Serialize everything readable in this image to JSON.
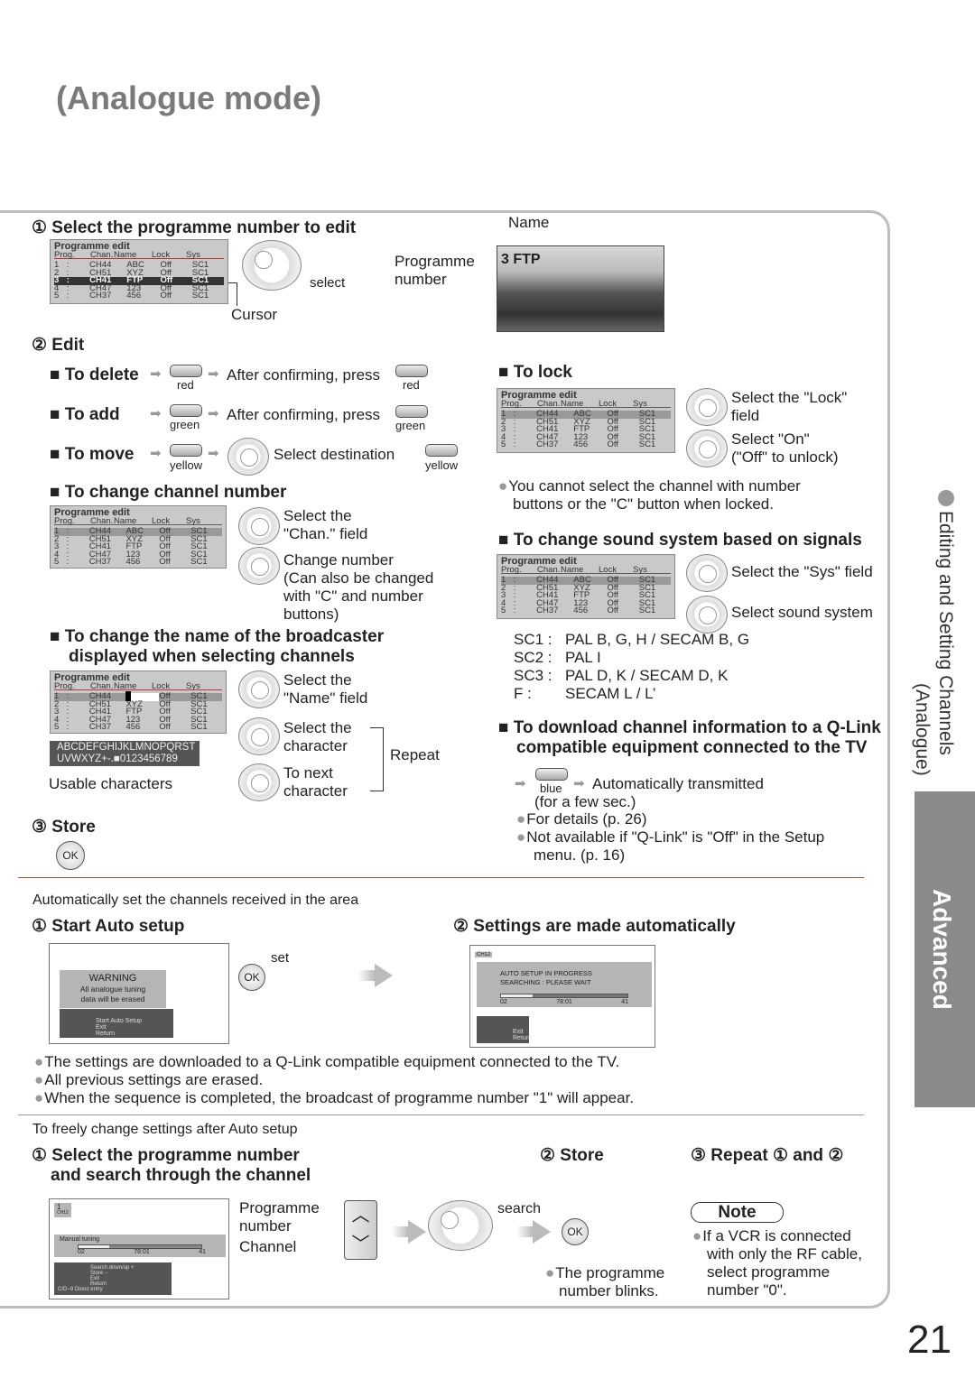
{
  "title": "(Analogue mode)",
  "side": {
    "section": "Editing and Setting Channels",
    "sub": "(Analogue)",
    "tab": "Advanced"
  },
  "page_number": "21",
  "colors": {
    "side_tab": "#8a8a8a",
    "title": "#7a7a7a",
    "divider": "#8a5a4a"
  },
  "step1": {
    "heading": "① Select the programme number to edit",
    "select": "select",
    "cursor": "Cursor",
    "programme_number": [
      "Programme",
      "number"
    ],
    "name": "Name",
    "photo_label": "3  FTP"
  },
  "tables": {
    "title": "Programme edit",
    "headers": [
      "Prog.",
      "Chan.",
      "Name",
      "Lock",
      "Sys"
    ],
    "rows": [
      [
        "1",
        ":",
        "CH44",
        "ABC",
        "Off",
        "SC1"
      ],
      [
        "2",
        ":",
        "CH51",
        "XYZ",
        "Off",
        "SC1"
      ],
      [
        "3",
        ":",
        "CH41",
        "FTP",
        "Off",
        "SC1"
      ],
      [
        "4",
        ":",
        "CH47",
        "123",
        "Off",
        "SC1"
      ],
      [
        "5",
        ":",
        "CH37",
        "456",
        "Off",
        "SC1"
      ]
    ]
  },
  "edit": {
    "heading": "② Edit",
    "delete": {
      "label": "■ To delete",
      "btn": "red",
      "after": "After confirming, press",
      "btn2": "red"
    },
    "add": {
      "label": "■ To add",
      "btn": "green",
      "after": "After confirming, press",
      "btn2": "green"
    },
    "move": {
      "label": "■ To move",
      "btn": "yellow",
      "after": "Select destination",
      "btn2": "yellow"
    },
    "chan": {
      "heading": "■ To change channel number",
      "s1": [
        "Select the",
        "\"Chan.\" field"
      ],
      "s2": [
        "Change number",
        "(Can also be changed",
        "with \"C\" and number",
        "buttons)"
      ]
    },
    "name": {
      "heading": [
        "■ To change the name of the broadcaster",
        "displayed when selecting channels"
      ],
      "s1": [
        "Select the",
        "\"Name\" field"
      ],
      "s2": [
        "Select the",
        "character"
      ],
      "s3": [
        "To next",
        "character"
      ],
      "repeat": "Repeat",
      "chars": [
        "ABCDEFGHIJKLMNOPQRST",
        "UVWXYZ+-.■0123456789"
      ],
      "usable": "Usable characters"
    }
  },
  "store": {
    "heading": "③ Store",
    "ok": "OK"
  },
  "lock": {
    "heading": "■ To lock",
    "s1": [
      "Select the \"Lock\"",
      "field"
    ],
    "s2": [
      "Select \"On\"",
      "(\"Off\" to unlock)"
    ],
    "note": [
      "You cannot select the channel with number",
      "buttons or the \"C\" button when locked."
    ]
  },
  "sound": {
    "heading": "■ To change sound system based on signals",
    "s1": "Select the \"Sys\" field",
    "s2": "Select sound system",
    "systems": [
      {
        "k": "SC1 :",
        "v": "PAL B, G, H / SECAM B, G"
      },
      {
        "k": "SC2 :",
        "v": "PAL I"
      },
      {
        "k": "SC3 :",
        "v": "PAL D, K / SECAM D, K"
      },
      {
        "k": "F :",
        "v": "SECAM L / L’"
      }
    ]
  },
  "qlink": {
    "heading": [
      "■ To download channel information to a Q-Link",
      "compatible equipment connected to the TV"
    ],
    "btn": "blue",
    "auto": "Automatically transmitted",
    "few": "(for a few sec.)",
    "b1": "For details (p. 26)",
    "b2": [
      "Not available if \"Q-Link\" is \"Off\" in the Setup",
      "menu. (p. 16)"
    ]
  },
  "auto": {
    "intro": "Automatically set the channels received in the area",
    "s1": "① Start Auto setup",
    "s2": "② Settings are made automatically",
    "set": "set",
    "ok": "OK",
    "warn": [
      "WARNING",
      "All  analogue  tuning",
      "data  will  be  erased"
    ],
    "ctrl1": [
      "Start Auto Setup",
      "Exit",
      "Return"
    ],
    "ch": "CH12",
    "prog": [
      "AUTO  SETUP  IN  PROGRESS",
      "SEARCHING  :     PLEASE  WAIT"
    ],
    "scale": [
      "02",
      "78:01",
      "41"
    ],
    "ctrl2": [
      "Exit",
      "Return"
    ],
    "progress": 0.25,
    "bullets": [
      "The settings are downloaded to a Q-Link compatible equipment connected to the TV.",
      "All previous settings are erased.",
      "When the sequence is completed, the broadcast of programme number \"1\" will appear."
    ]
  },
  "manual": {
    "intro": "To freely change settings after Auto setup",
    "s1": [
      "① Select the programme number",
      "and search through the channel"
    ],
    "s2": "② Store",
    "s3": "③ Repeat ① and ②",
    "prog_label": [
      "Programme",
      "number"
    ],
    "chan_label": "Channel",
    "search": "search",
    "ok": "OK",
    "blinks": [
      "The programme",
      "number blinks."
    ],
    "scr": {
      "num": "1",
      "ch": "CH12",
      "title": "Manual tuning",
      "scale": [
        "02",
        "78:01",
        "41"
      ],
      "ctrl": [
        "Search down/up",
        "Store",
        "Exit",
        "Return",
        "Direct entry"
      ],
      "plus": "+",
      "minus": "−",
      "keys": [
        "C",
        "D",
        "9"
      ]
    },
    "progress": 0.25,
    "note_title": "Note",
    "note": [
      "If a VCR is connected",
      "with only the RF cable,",
      "select programme",
      "number \"0\"."
    ]
  }
}
